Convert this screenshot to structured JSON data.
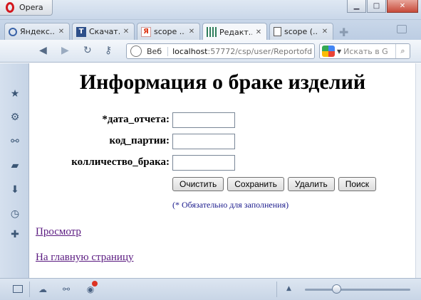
{
  "window": {
    "app_button_label": "Opera",
    "controls": [
      "minimize",
      "maximize",
      "close"
    ]
  },
  "tabs": [
    {
      "label": "Яндекс...",
      "icon": "opera-speed-dial-icon",
      "active": false
    },
    {
      "label": "Скачат...",
      "icon": "t-site-icon",
      "active": false
    },
    {
      "label": "scope ...",
      "icon": "yandex-icon",
      "active": false
    },
    {
      "label": "Редакт...",
      "icon": "csp-grid-icon",
      "active": true
    },
    {
      "label": "scope (...",
      "icon": "document-icon",
      "active": false
    }
  ],
  "navbar": {
    "web_label": "Веб",
    "url_host": "localhost",
    "url_rest": ":57772/csp/user/Reportofd",
    "search_placeholder": "Искать в G"
  },
  "sidebar": {
    "items": [
      "bookmarks-star-icon",
      "settings-gear-icon",
      "unite-icon",
      "notes-icon",
      "downloads-icon",
      "history-clock-icon",
      "add-panel-icon"
    ]
  },
  "page": {
    "title": "Информация о браке изделий",
    "fields": [
      {
        "label": "*дата_отчета:",
        "value": ""
      },
      {
        "label": "код_партии:",
        "value": ""
      },
      {
        "label": "колличество_брака:",
        "value": ""
      }
    ],
    "buttons": {
      "clear": "Очистить",
      "save": "Сохранить",
      "delete": "Удалить",
      "search": "Поиск"
    },
    "required_note": "(* Обязательно для заполнения)",
    "links": {
      "view": "Просмотр",
      "home": "На главную страницу"
    }
  },
  "statusbar": {
    "items": [
      "panel-toggle-icon",
      "cloud-icon",
      "unite-icon",
      "turbo-icon"
    ],
    "zoom_level_fraction": 0.28
  },
  "colors": {
    "link": "#5a1a80",
    "required_note": "#1a1a8c",
    "chrome_blue": "#c9d7e9"
  }
}
